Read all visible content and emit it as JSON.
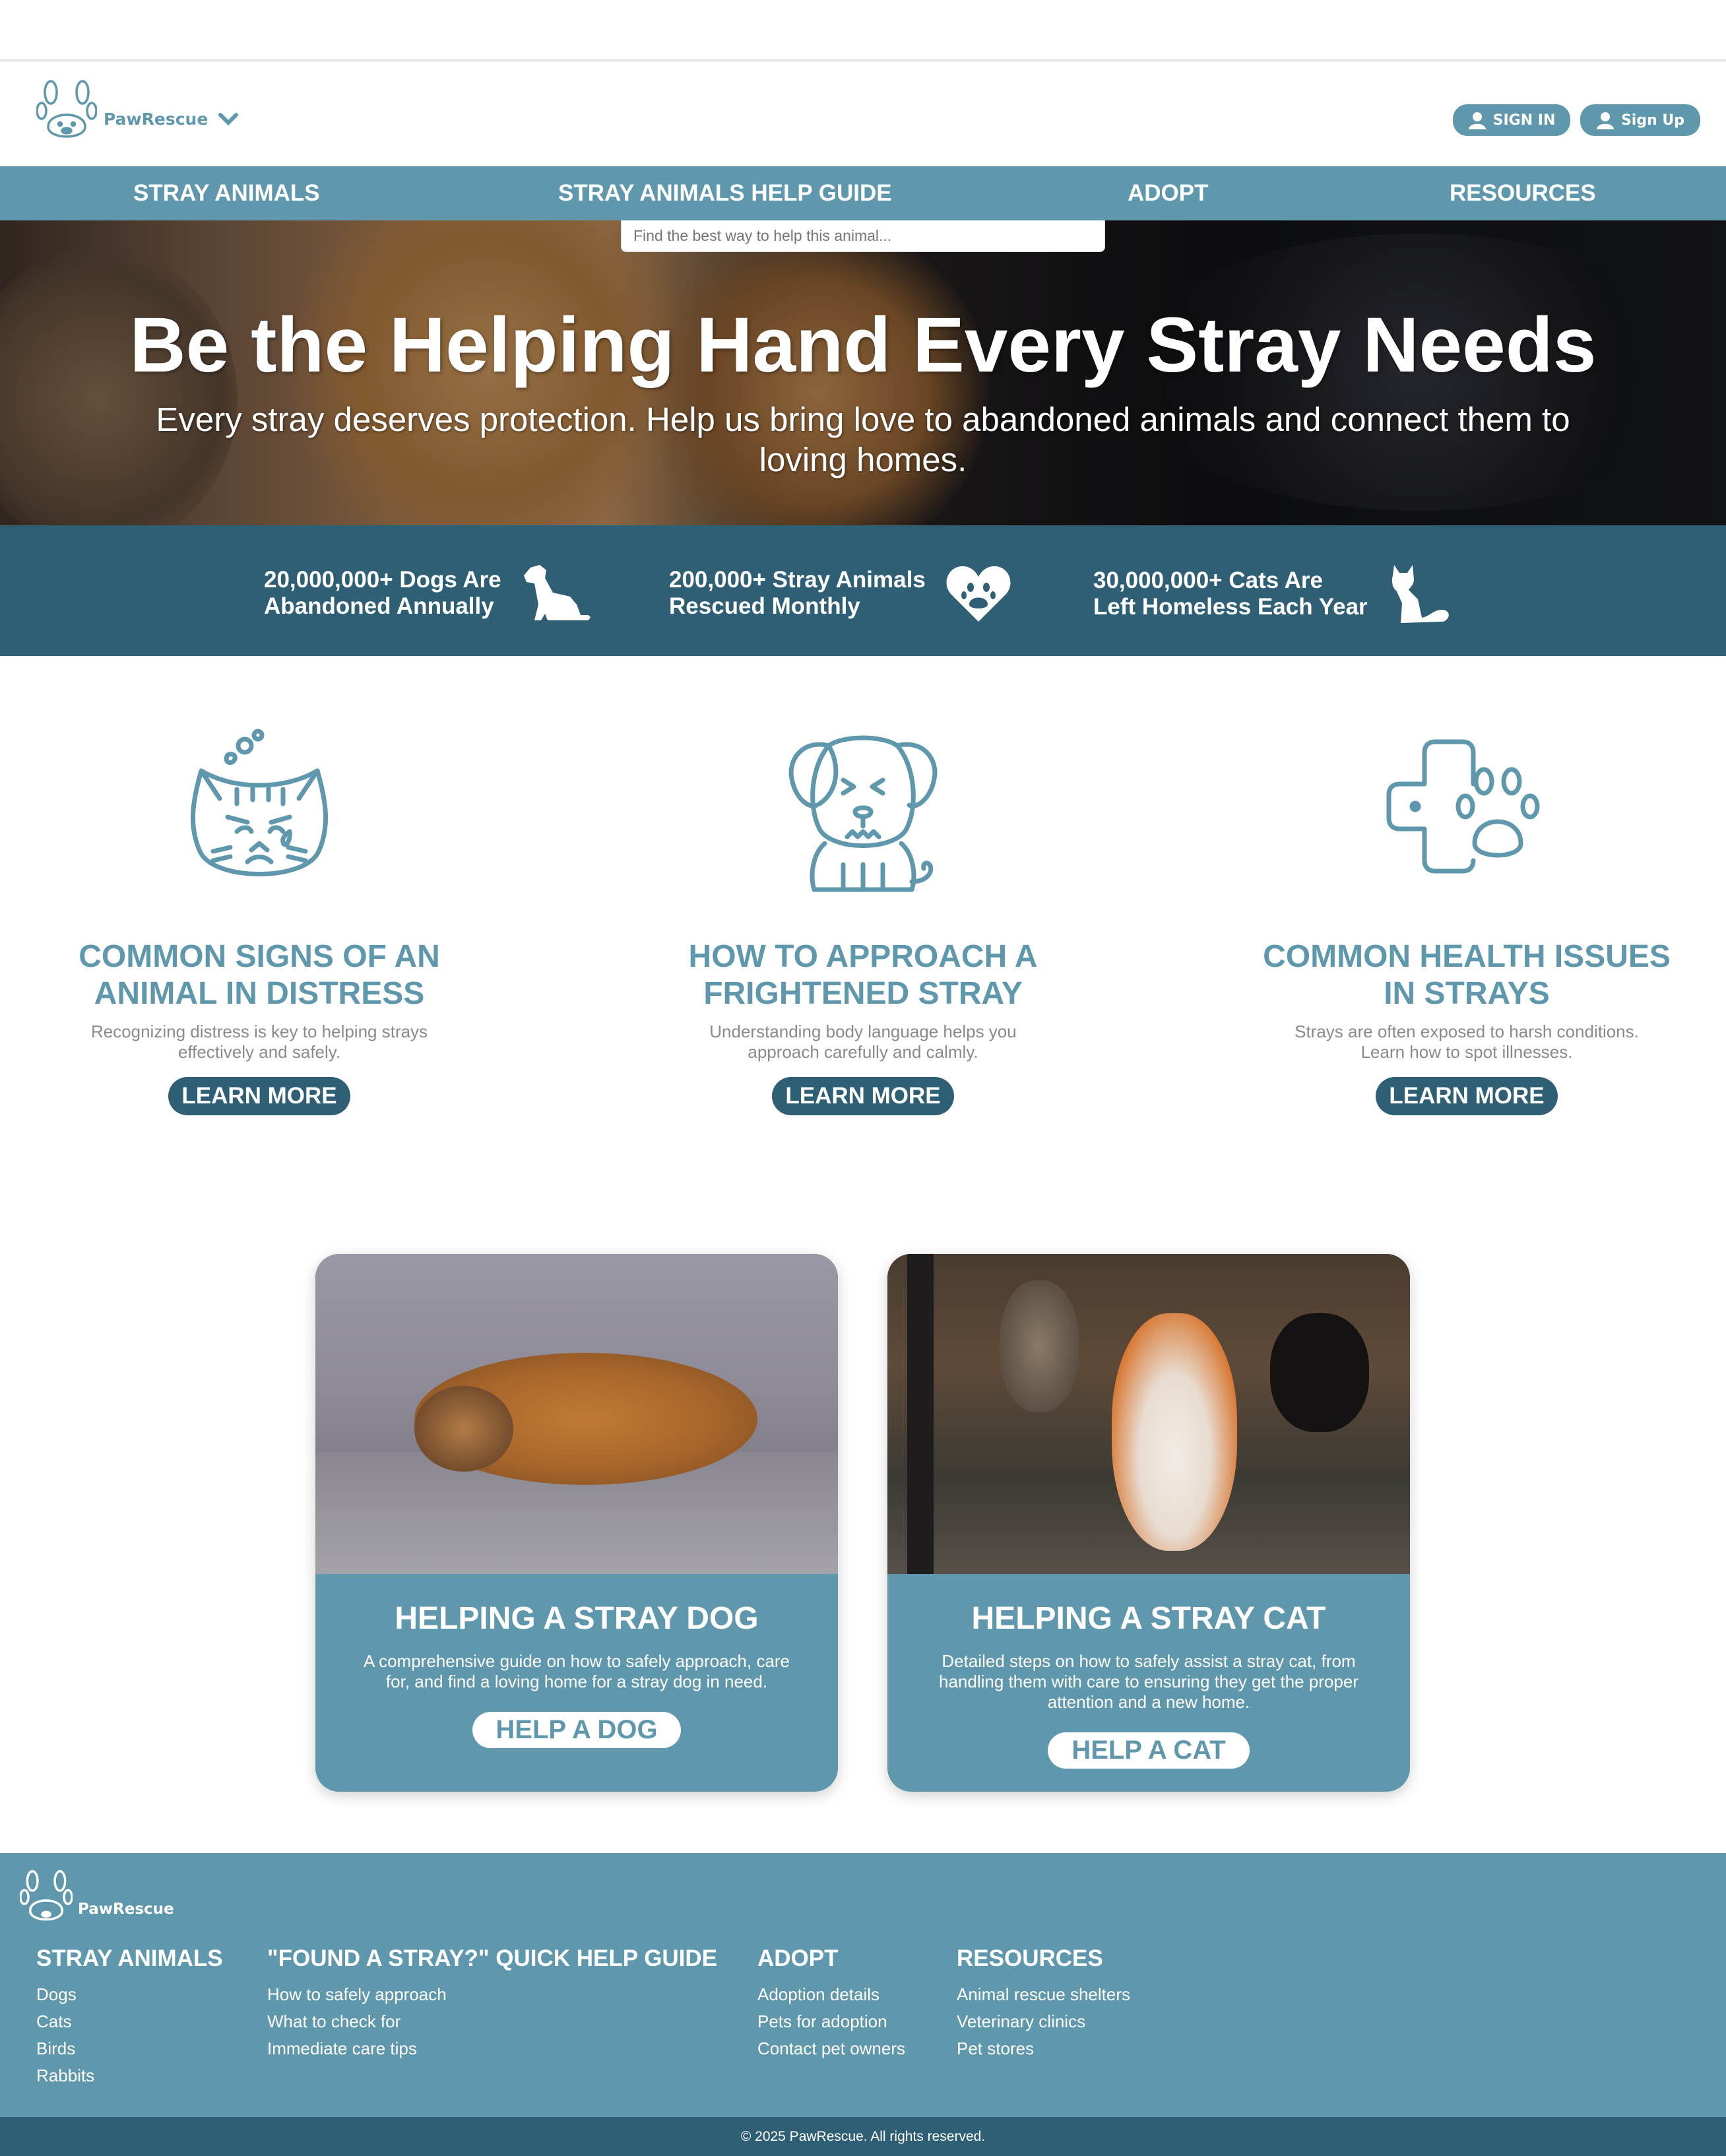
{
  "brand": {
    "name": "PawRescue",
    "accent": "#5f97ac",
    "dark": "#2f5f75"
  },
  "header": {
    "signin_label": "SIGN IN",
    "signup_label": "Sign Up"
  },
  "nav": {
    "items": [
      {
        "label": "STRAY ANIMALS"
      },
      {
        "label": "STRAY ANIMALS HELP GUIDE"
      },
      {
        "label": "ADOPT"
      },
      {
        "label": "RESOURCES"
      }
    ]
  },
  "search": {
    "placeholder": "Find the best way to help this animal..."
  },
  "hero": {
    "title": "Be the Helping Hand Every Stray Needs",
    "subtitle": "Every stray deserves protection. Help us bring love to abandoned animals and connect them to loving homes."
  },
  "stats": [
    {
      "line1": "20,000,000+ Dogs Are",
      "line2": "Abandoned Annually",
      "icon": "dog-icon"
    },
    {
      "line1": "200,000+ Stray Animals",
      "line2": "Rescued Monthly",
      "icon": "heart-paw-icon"
    },
    {
      "line1": "30,000,000+ Cats Are",
      "line2": "Left Homeless Each Year",
      "icon": "cat-icon"
    }
  ],
  "info": [
    {
      "title_line1": "COMMON SIGNS OF AN",
      "title_line2": "ANIMAL IN DISTRESS",
      "desc": "Recognizing distress is key to helping strays effectively and safely.",
      "button": "LEARN MORE",
      "icon": "sad-cat-icon"
    },
    {
      "title_line1": "HOW TO APPROACH A",
      "title_line2": "FRIGHTENED STRAY",
      "desc": "Understanding body language helps you approach carefully and calmly.",
      "button": "LEARN MORE",
      "icon": "scared-dog-icon"
    },
    {
      "title_line1": "COMMON HEALTH ISSUES",
      "title_line2": "IN STRAYS",
      "desc": "Strays are often exposed to harsh conditions. Learn how to spot illnesses.",
      "button": "LEARN MORE",
      "icon": "medical-paw-icon"
    }
  ],
  "cards": [
    {
      "title": "HELPING A STRAY DOG",
      "desc": "A comprehensive guide on how to safely approach, care for, and find a loving home for a stray dog in need.",
      "button": "HELP A DOG"
    },
    {
      "title": "HELPING A STRAY CAT",
      "desc": "Detailed steps on how to safely assist a stray cat, from handling them with care to ensuring they get the proper attention and a new home.",
      "button": "HELP A CAT"
    }
  ],
  "footer": {
    "brand": "PawRescue",
    "columns": [
      {
        "heading": "STRAY ANIMALS",
        "links": [
          "Dogs",
          "Cats",
          "Birds",
          "Rabbits"
        ]
      },
      {
        "heading": "\"FOUND A STRAY?\" QUICK HELP GUIDE",
        "links": [
          "How to safely approach",
          "What to check for",
          "Immediate care tips"
        ]
      },
      {
        "heading": "ADOPT",
        "links": [
          "Adoption details",
          "Pets for adoption",
          "Contact pet owners"
        ]
      },
      {
        "heading": "RESOURCES",
        "links": [
          "Animal rescue shelters",
          "Veterinary clinics",
          "Pet stores"
        ]
      }
    ],
    "copyright": "© 2025 PawRescue. All rights reserved."
  }
}
